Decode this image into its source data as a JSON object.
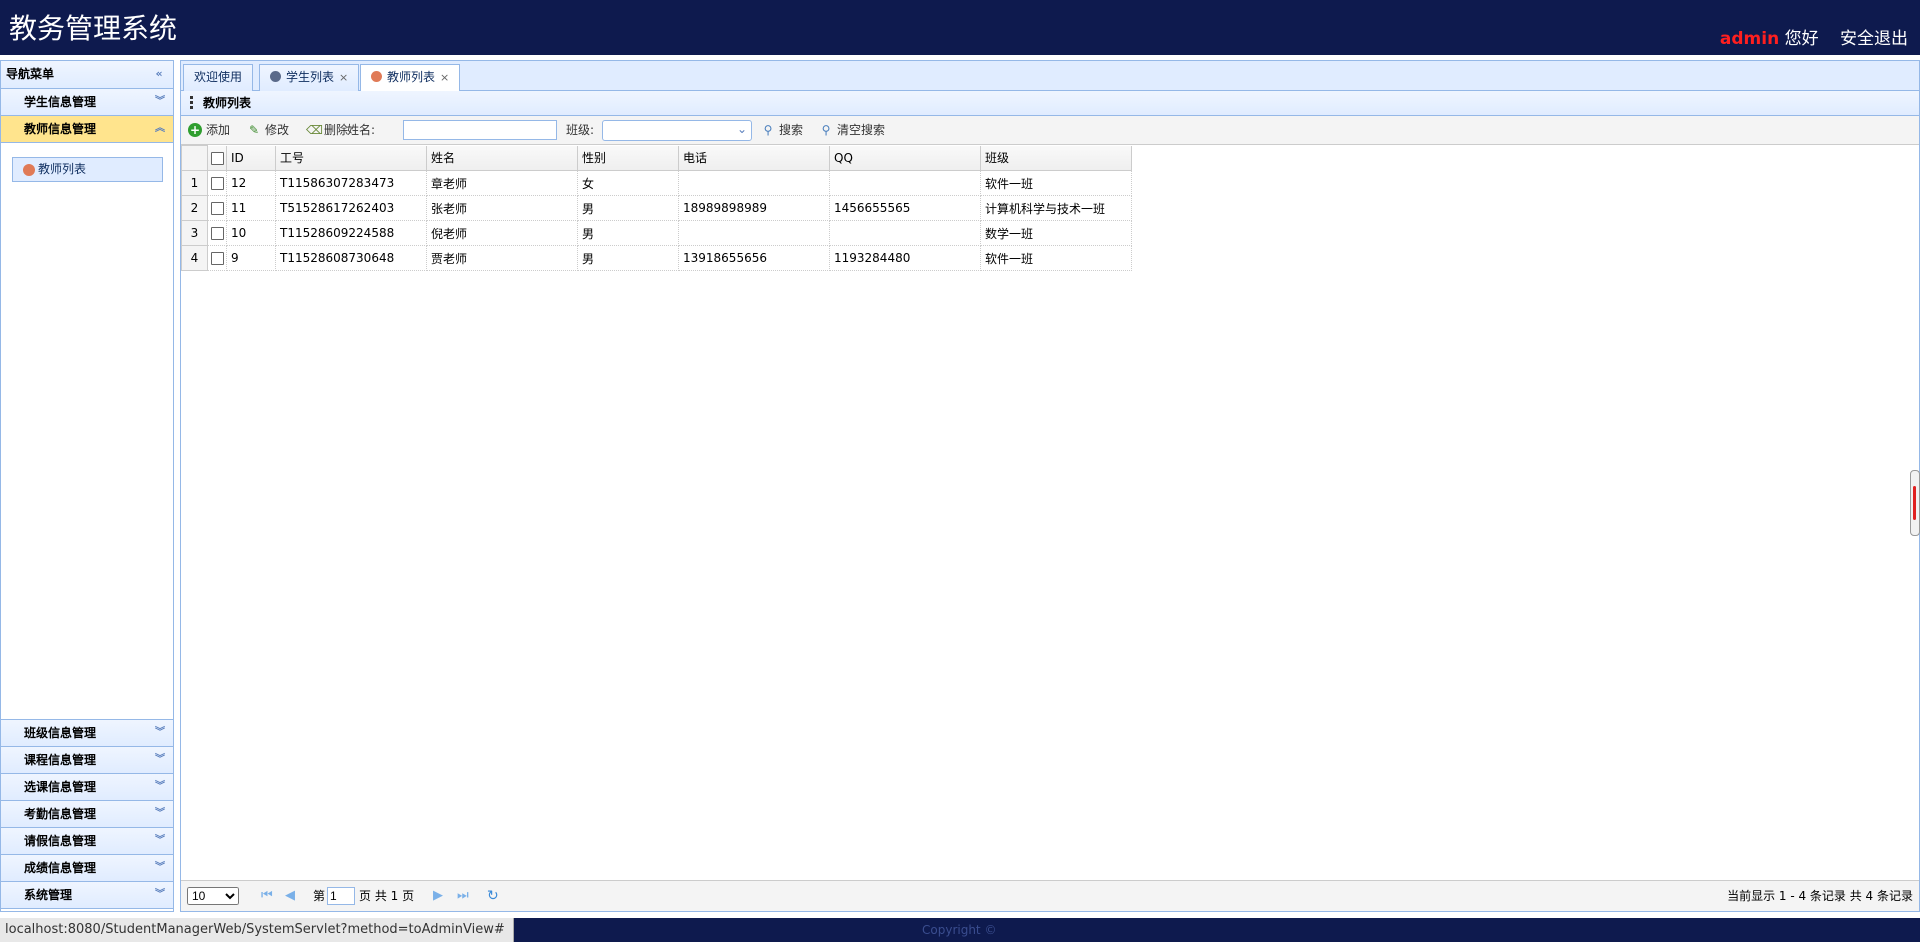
{
  "header": {
    "title": "教务管理系统",
    "user": "admin",
    "greeting": "您好",
    "logout": "安全退出"
  },
  "sidebar": {
    "nav_title": "导航菜单",
    "top_items": [
      {
        "label": "学生信息管理"
      },
      {
        "label": "教师信息管理"
      }
    ],
    "sub_item": "教师列表",
    "bottom_items": [
      {
        "label": "班级信息管理"
      },
      {
        "label": "课程信息管理"
      },
      {
        "label": "选课信息管理"
      },
      {
        "label": "考勤信息管理"
      },
      {
        "label": "请假信息管理"
      },
      {
        "label": "成绩信息管理"
      },
      {
        "label": "系统管理"
      }
    ]
  },
  "tabs": [
    {
      "label": "欢迎使用"
    },
    {
      "label": "学生列表"
    },
    {
      "label": "教师列表"
    }
  ],
  "panel": {
    "title": "教师列表"
  },
  "toolbar": {
    "add": "添加",
    "edit": "修改",
    "delete": "删除",
    "name_label": "姓名:",
    "class_label": "班级:",
    "search": "搜索",
    "clear_search": "清空搜索"
  },
  "grid": {
    "columns": [
      "ID",
      "工号",
      "姓名",
      "性别",
      "电话",
      "QQ",
      "班级"
    ],
    "rows": [
      {
        "num": "1",
        "id": "12",
        "sn": "T11586307283473",
        "name": "章老师",
        "sex": "女",
        "phone": "",
        "qq": "",
        "clazz": "软件一班"
      },
      {
        "num": "2",
        "id": "11",
        "sn": "T51528617262403",
        "name": "张老师",
        "sex": "男",
        "phone": "18989898989",
        "qq": "1456655565",
        "clazz": "计算机科学与技术一班"
      },
      {
        "num": "3",
        "id": "10",
        "sn": "T11528609224588",
        "name": "倪老师",
        "sex": "男",
        "phone": "",
        "qq": "",
        "clazz": "数学一班"
      },
      {
        "num": "4",
        "id": "9",
        "sn": "T11528608730648",
        "name": "贾老师",
        "sex": "男",
        "phone": "13918655656",
        "qq": "1193284480",
        "clazz": "软件一班"
      }
    ]
  },
  "pager": {
    "page_size": "10",
    "page_prefix": "第",
    "page_value": "1",
    "page_suffix": "页 共 1 页",
    "summary": "当前显示 1 - 4 条记录 共 4 条记录"
  },
  "status": {
    "url": "localhost:8080/StudentManagerWeb/SystemServlet?method=toAdminView#",
    "copyright": "Copyright ©"
  }
}
